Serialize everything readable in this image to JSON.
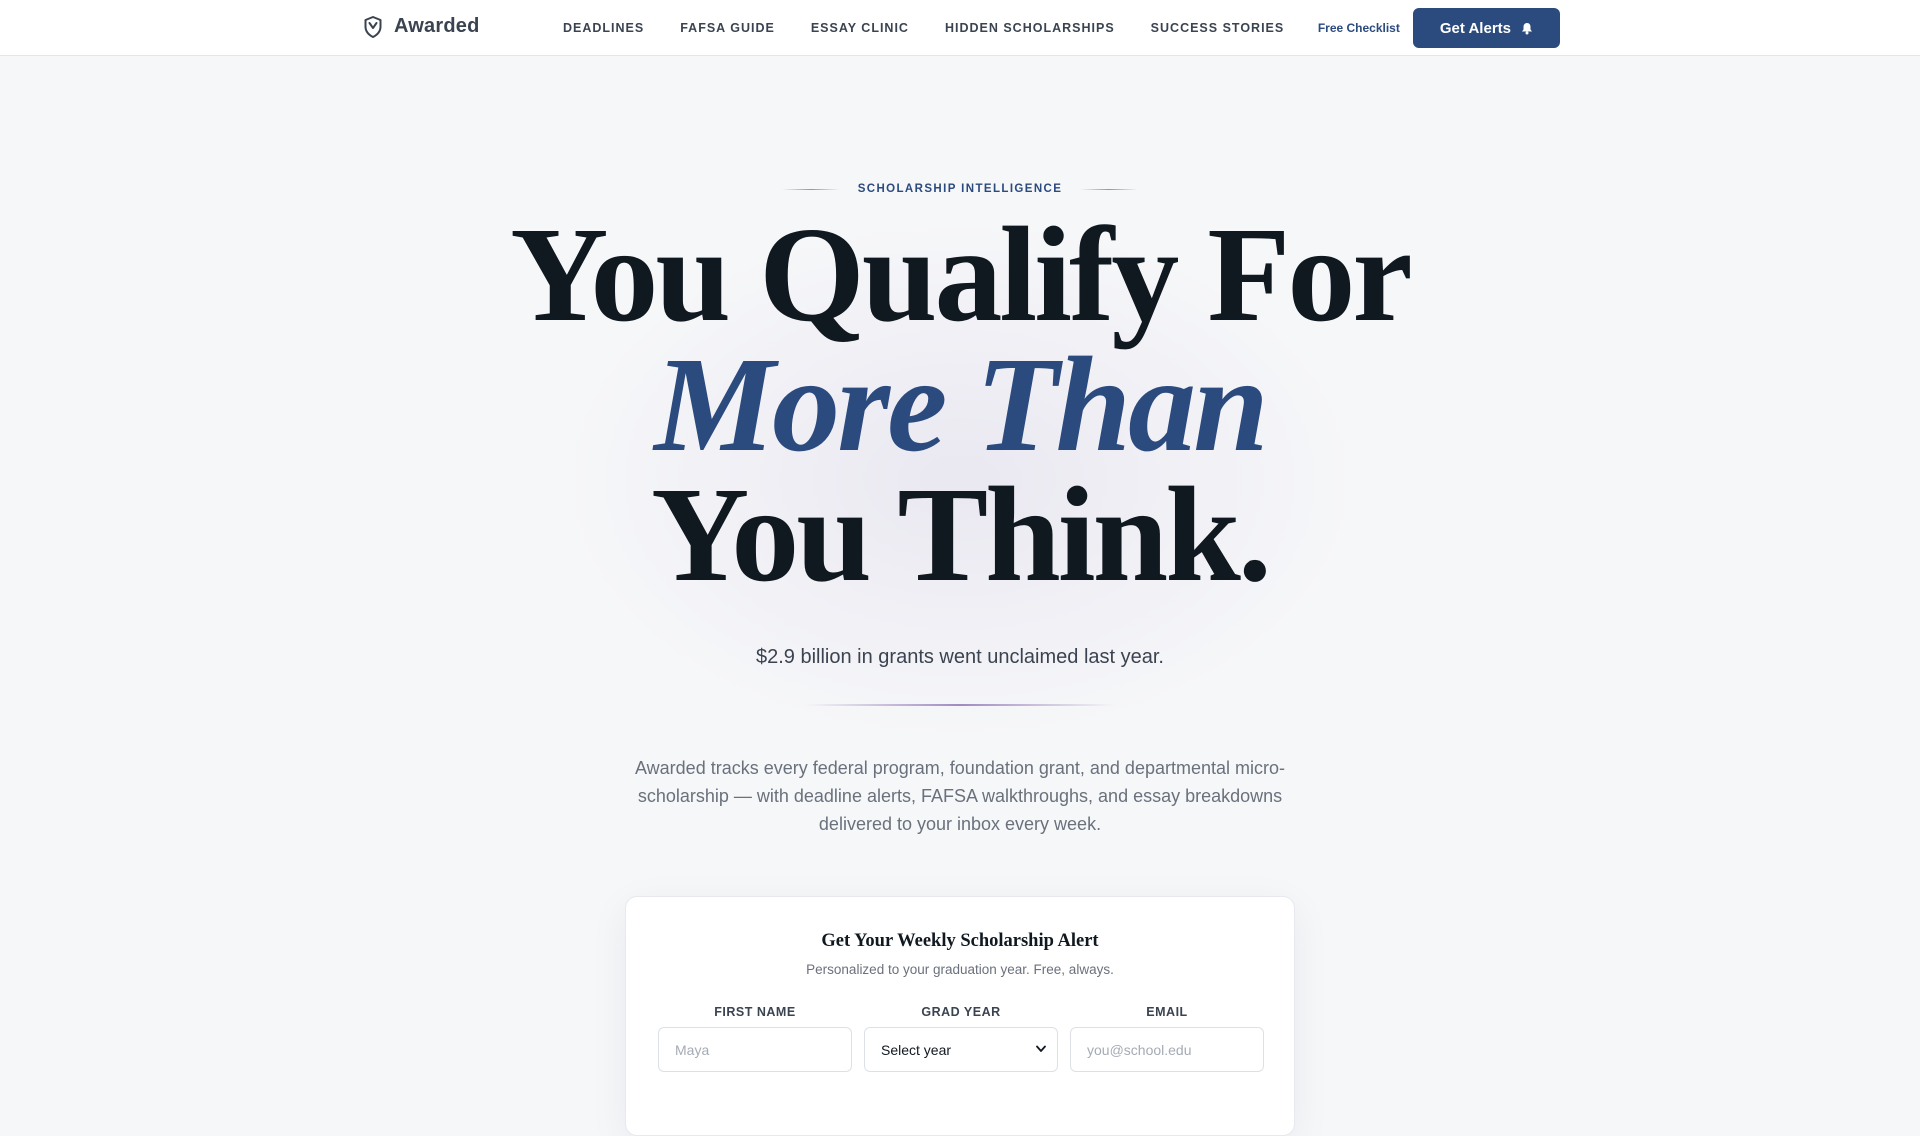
{
  "nav": {
    "brand": "Awarded",
    "links": [
      "DEADLINES",
      "FAFSA GUIDE",
      "ESSAY CLINIC",
      "HIDDEN SCHOLARSHIPS",
      "SUCCESS STORIES"
    ],
    "checklist_label": "Free Checklist",
    "cta_label": "Get Alerts",
    "icons": {
      "brand": "shield-icon",
      "cta": "bell-icon"
    }
  },
  "hero": {
    "eyebrow": "SCHOLARSHIP INTELLIGENCE",
    "headline_line1": "You Qualify For",
    "headline_line2": "More Than",
    "headline_line3": "You Think.",
    "stat": "$2.9 billion in grants went unclaimed last year.",
    "description": "Awarded tracks every federal program, foundation grant, and departmental micro-scholarship — with deadline alerts, FAFSA walkthroughs, and essay breakdowns delivered to your inbox every week."
  },
  "form": {
    "title": "Get Your Weekly Scholarship Alert",
    "subtitle": "Personalized to your graduation year. Free, always.",
    "first_name": {
      "label": "FIRST NAME",
      "placeholder": "Maya"
    },
    "grad_year": {
      "label": "GRAD YEAR",
      "selected": "Select year"
    },
    "email": {
      "label": "EMAIL",
      "placeholder": "you@school.edu"
    }
  },
  "colors": {
    "accent": "#2b4a7e",
    "heading": "#101820",
    "background": "#f6f7f9"
  }
}
